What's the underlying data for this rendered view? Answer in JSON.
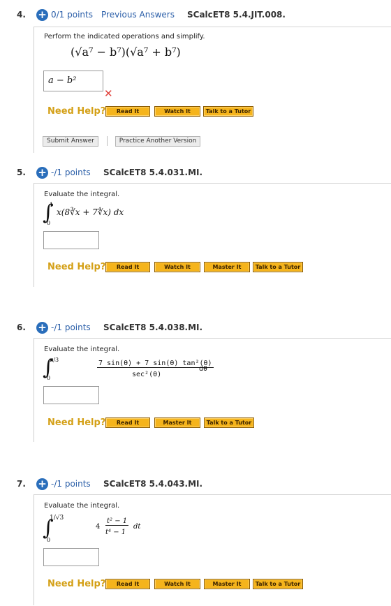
{
  "questions": [
    {
      "number": "4.",
      "points": "0/1 points",
      "previous_answers": "Previous Answers",
      "id": "SCalcET8 5.4.JIT.008.",
      "prompt": "Perform the indicated operations and simplify.",
      "expression": "(√a⁷ − b⁷)(√a⁷ + b⁷)",
      "answer_value": "a − b²",
      "help_label": "Need Help?",
      "help_buttons": [
        "Read It",
        "Watch It",
        "Talk to a Tutor"
      ],
      "submit_label": "Submit Answer",
      "practice_label": "Practice Another Version"
    },
    {
      "number": "5.",
      "points": "-/1 points",
      "id": "SCalcET8 5.4.031.MI.",
      "prompt": "Evaluate the integral.",
      "upper": "1",
      "lower": "0",
      "integrand": "x(8∛x + 7∜x) dx",
      "help_label": "Need Help?",
      "help_buttons": [
        "Read It",
        "Watch It",
        "Master It",
        "Talk to a Tutor"
      ]
    },
    {
      "number": "6.",
      "points": "-/1 points",
      "id": "SCalcET8 5.4.038.MI.",
      "prompt": "Evaluate the integral.",
      "upper": "π/3",
      "lower": "0",
      "numerator": "7 sin(θ) + 7 sin(θ) tan²(θ)",
      "denominator": "sec²(θ)",
      "differential": "dθ",
      "help_label": "Need Help?",
      "help_buttons": [
        "Read It",
        "Master It",
        "Talk to a Tutor"
      ]
    },
    {
      "number": "7.",
      "points": "-/1 points",
      "id": "SCalcET8 5.4.043.MI.",
      "prompt": "Evaluate the integral.",
      "upper": "1/√3",
      "lower": "0",
      "coef": "4",
      "numerator": "t² − 1",
      "denominator": "t⁴ − 1",
      "differential": "dt",
      "help_label": "Need Help?",
      "help_buttons": [
        "Read It",
        "Watch It",
        "Master It",
        "Talk to a Tutor"
      ]
    }
  ],
  "icons": {
    "expand": "plus-circle-icon",
    "wrong": "x-mark-icon"
  },
  "colors": {
    "link": "#2a5ea8",
    "plus": "#2a6ebb",
    "help": "#d4a017",
    "button": "#f5b41c",
    "wrong": "#e0403a"
  }
}
